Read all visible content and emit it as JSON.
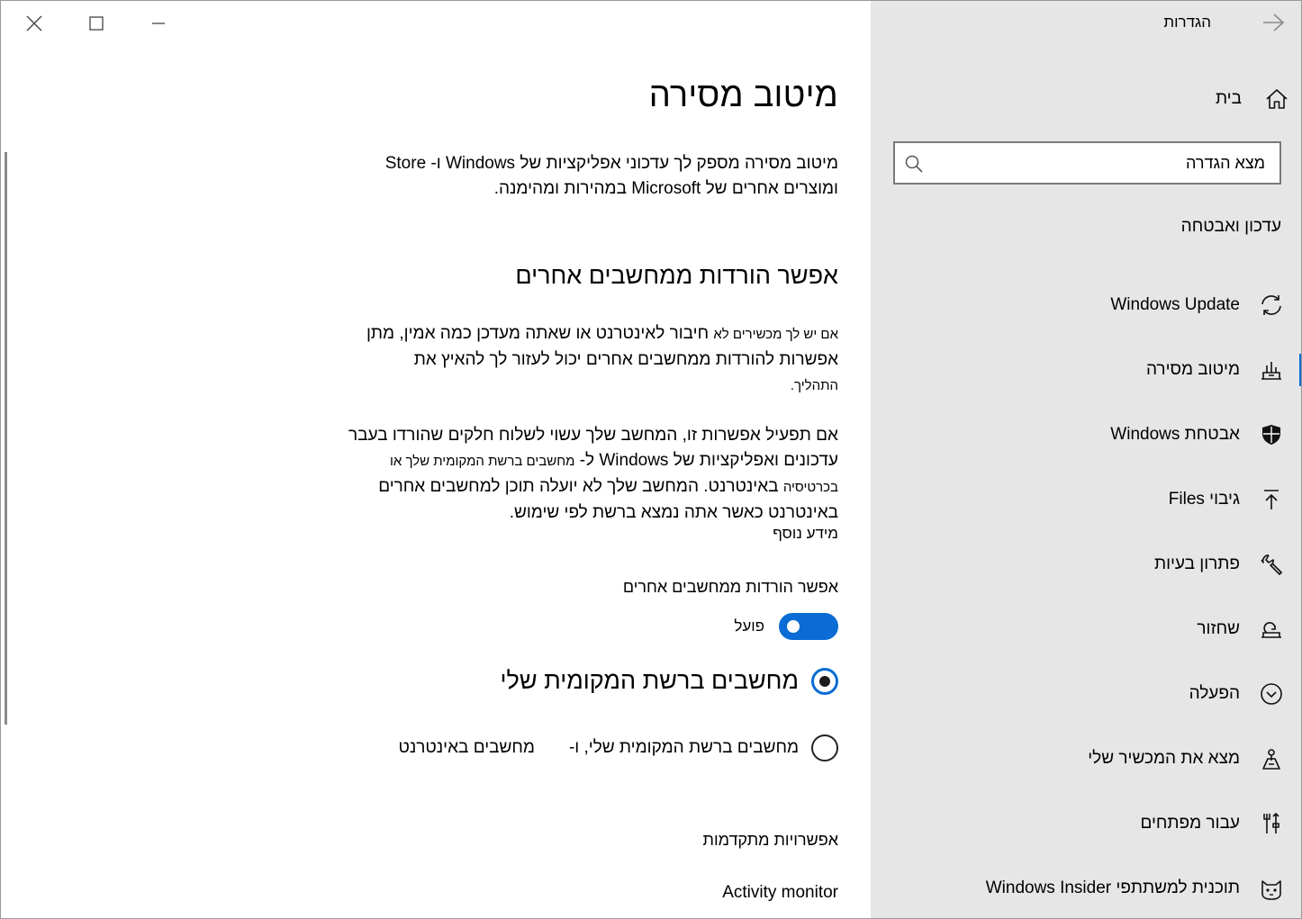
{
  "window": {
    "controls": [
      "close-icon",
      "maximize-icon",
      "minimize-icon"
    ]
  },
  "nav": {
    "header": "הגדרות",
    "home_label": "בית",
    "search_placeholder": "מצא הגדרה",
    "section_title": "עדכון ואבטחה",
    "items": [
      {
        "label": "Windows Update",
        "icon": "sync-icon"
      },
      {
        "label": "מיטוב מסירה",
        "icon": "delivery-optimization-icon",
        "selected": true
      },
      {
        "label": "אבטחת Windows",
        "icon": "shield-icon"
      },
      {
        "label": "גיבוי Files",
        "icon": "backup-arrow-icon"
      },
      {
        "label": "פתרון בעיות",
        "icon": "wrench-icon"
      },
      {
        "label": "שחזור",
        "icon": "recovery-icon"
      },
      {
        "label": "הפעלה",
        "icon": "activation-check-icon"
      },
      {
        "label": "מצא את המכשיר שלי",
        "icon": "find-device-icon"
      },
      {
        "label": "עבור מפתחים",
        "icon": "developer-tools-icon"
      },
      {
        "label": "תוכנית למשתתפי Windows Insider",
        "icon": "insider-cat-icon"
      }
    ]
  },
  "main": {
    "title": "מיטוב מסירה",
    "intro": "מיטוב מסירה מספק לך עדכוני אפליקציות של Windows ו- Store ומוצרים אחרים של Microsoft במהירות ומהימנה.",
    "section_title": "אפשר הורדות ממחשבים אחרים",
    "para1_lead": "אם יש לך מכשירים לא",
    "para1_rest": "חיבור לאינטרנט או שאתה מעדכן כמה אמין, מתן אפשרות להורדות ממחשבים אחרים יכול לעזור לך להאיץ את",
    "para1_end": "התהליך.",
    "para2_a": "אם תפעיל אפשרות זו, המחשב שלך עשוי לשלוח חלקים שהורדו בעבר עדכונים ואפליקציות של Windows ל-",
    "para2_b": "מחשבים ברשת המקומית שלך או בכרטיסיה",
    "para2_c": "באינטרנט. המחשב שלך לא יועלה תוכן למחשבים אחרים באינטרנט כאשר אתה נמצא ברשת לפי שימוש.",
    "learn_more": "מידע נוסף",
    "toggle_label": "אפשר הורדות ממחשבים אחרים",
    "toggle_state": "פועל",
    "radio_local": "מחשבים ברשת המקומית שלי",
    "radio_internet_a": "מחשבים ברשת המקומית שלי, ו-",
    "radio_internet_b": "מחשבים באינטרנט",
    "advanced_options": "אפשרויות מתקדמות",
    "activity_monitor": "Activity monitor"
  }
}
